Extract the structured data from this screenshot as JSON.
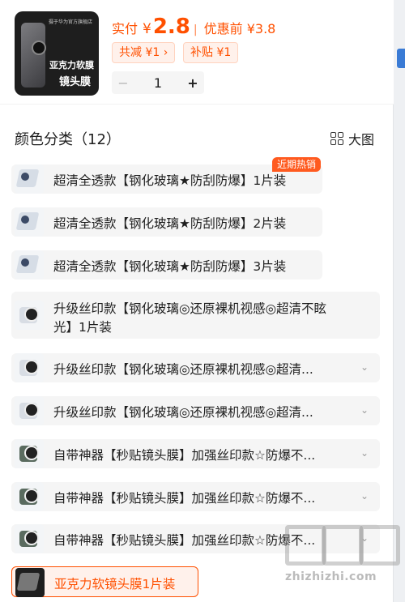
{
  "header": {
    "thumb": {
      "t0": "摄于华为官方旗舰店",
      "t1": "亚克力软膜",
      "t2": "镜头膜"
    },
    "price_label": "实付",
    "price_yen": "¥",
    "price_value": "2.8",
    "price_sep": "|",
    "orig_label": "优惠前 ¥3.8",
    "tag1": "共减 ¥1 ›",
    "tag2": "补贴 ¥1",
    "qty_minus": "−",
    "qty_value": "1",
    "qty_plus": "+"
  },
  "section": {
    "title": "颜色分类（12）",
    "bigview_label": "大图"
  },
  "hot_badge": "近期热销",
  "options": [
    {
      "label": "超清全透款【钢化玻璃★防刮防爆】1片装"
    },
    {
      "label": "超清全透款【钢化玻璃★防刮防爆】2片装"
    },
    {
      "label": "超清全透款【钢化玻璃★防刮防爆】3片装"
    },
    {
      "label_line1": "升级丝印款【钢化玻璃◎还原裸机视感◎超清不眩",
      "label_line2": "光】1片装"
    },
    {
      "label": "升级丝印款【钢化玻璃◎还原裸机视感◎超清...",
      "chevron": "⌄"
    },
    {
      "label": "升级丝印款【钢化玻璃◎还原裸机视感◎超清...",
      "chevron": "⌄"
    },
    {
      "label": "自带神器【秒贴镜头膜】加强丝印款☆防爆不...",
      "chevron": "⌄"
    },
    {
      "label": "自带神器【秒贴镜头膜】加强丝印款☆防爆不...",
      "chevron": "⌄"
    },
    {
      "label": "自带神器【秒贴镜头膜】加强丝印款☆防爆不...",
      "chevron": "⌄"
    },
    {
      "label": "亚克力软镜头膜1片装"
    }
  ],
  "watermark": "zhizhizhi.com",
  "colors": {
    "accent": "#ff5000",
    "badge": "#ff5a1f",
    "option_bg": "#f5f5f5"
  }
}
